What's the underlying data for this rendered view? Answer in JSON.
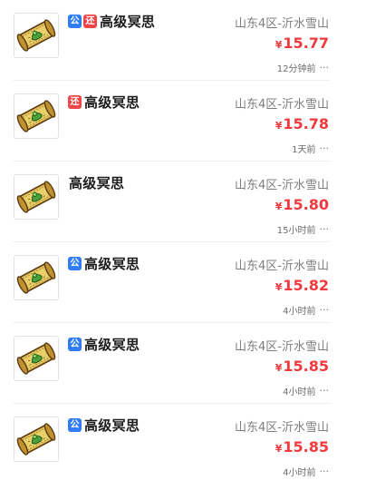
{
  "items": [
    {
      "badges": [
        {
          "text": "公",
          "kind": "public"
        },
        {
          "text": "还",
          "kind": "return"
        }
      ],
      "title": "高级冥思",
      "server": "山东4区-沂水雪山",
      "currency": "¥",
      "price": "15.77",
      "time": "12分钟前",
      "more": "···"
    },
    {
      "badges": [
        {
          "text": "还",
          "kind": "return"
        }
      ],
      "title": "高级冥思",
      "server": "山东4区-沂水雪山",
      "currency": "¥",
      "price": "15.78",
      "time": "1天前",
      "more": "···"
    },
    {
      "badges": [],
      "title": "高级冥思",
      "server": "山东4区-沂水雪山",
      "currency": "¥",
      "price": "15.80",
      "time": "15小时前",
      "more": "···"
    },
    {
      "badges": [
        {
          "text": "公",
          "kind": "public"
        }
      ],
      "title": "高级冥思",
      "server": "山东4区-沂水雪山",
      "currency": "¥",
      "price": "15.82",
      "time": "4小时前",
      "more": "···"
    },
    {
      "badges": [
        {
          "text": "公",
          "kind": "public"
        }
      ],
      "title": "高级冥思",
      "server": "山东4区-沂水雪山",
      "currency": "¥",
      "price": "15.85",
      "time": "4小时前",
      "more": "···"
    },
    {
      "badges": [
        {
          "text": "公",
          "kind": "public"
        }
      ],
      "title": "高级冥思",
      "server": "山东4区-沂水雪山",
      "currency": "¥",
      "price": "15.85",
      "time": "4小时前",
      "more": "···"
    }
  ],
  "icon": "scroll-item-icon",
  "colors": {
    "price": "#f2393d",
    "public_badge": "#2f7cf6",
    "return_badge": "#f2454a"
  }
}
